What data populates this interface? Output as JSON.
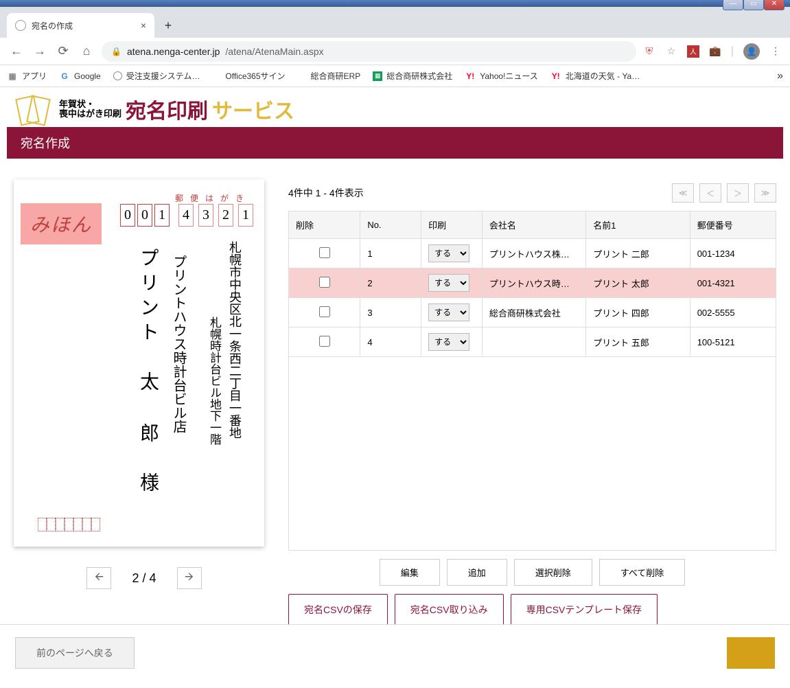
{
  "browser": {
    "tab_title": "宛名の作成",
    "url_domain": "atena.nenga-center.jp",
    "url_path": "/atena/AtenaMain.aspx",
    "bookmarks": {
      "apps": "アプリ",
      "google": "Google",
      "system": "受注支援システム…",
      "office": "Office365サイン",
      "erp": "総合商研ERP",
      "sogo": "総合商研株式会社",
      "yahoo": "Yahoo!ニュース",
      "weather": "北海道の天気 - Ya…"
    }
  },
  "page": {
    "logo_line1": "年賀状・",
    "logo_line2": "喪中はがき印刷",
    "logo_title": "宛名印刷",
    "logo_suffix": "サービス",
    "section_title": "宛名作成"
  },
  "postcard": {
    "sample": "みほん",
    "postal_label": "郵便はがき",
    "postal_digits": [
      "0",
      "0",
      "1",
      "4",
      "3",
      "2",
      "1"
    ],
    "address1": "札幌市中央区北一条西二丁目一番地",
    "address2": "札幌時計台ビル地下一階",
    "company": "プリントハウス時計台ビル店",
    "name": "プリント　太 郎　様"
  },
  "pager": {
    "text": "2 / 4"
  },
  "table": {
    "count": "4件中 1 - 4件表示",
    "headers": {
      "del": "削除",
      "no": "No.",
      "print": "印刷",
      "company": "会社名",
      "name": "名前1",
      "zip": "郵便番号"
    },
    "print_option": "する",
    "rows": [
      {
        "no": "1",
        "company": "プリントハウス株…",
        "name": "プリント 二郎",
        "zip": "001-1234",
        "selected": false
      },
      {
        "no": "2",
        "company": "プリントハウス時…",
        "name": "プリント 太郎",
        "zip": "001-4321",
        "selected": true
      },
      {
        "no": "3",
        "company": "総合商研株式会社",
        "name": "プリント 四郎",
        "zip": "002-5555",
        "selected": false
      },
      {
        "no": "4",
        "company": "",
        "name": "プリント 五郎",
        "zip": "100-5121",
        "selected": false
      }
    ]
  },
  "buttons": {
    "edit": "編集",
    "add": "追加",
    "delete_selected": "選択削除",
    "delete_all": "すべて削除",
    "csv_save": "宛名CSVの保存",
    "csv_import": "宛名CSV取り込み",
    "csv_template": "専用CSVテンプレート保存",
    "back": "前のページへ戻る"
  }
}
